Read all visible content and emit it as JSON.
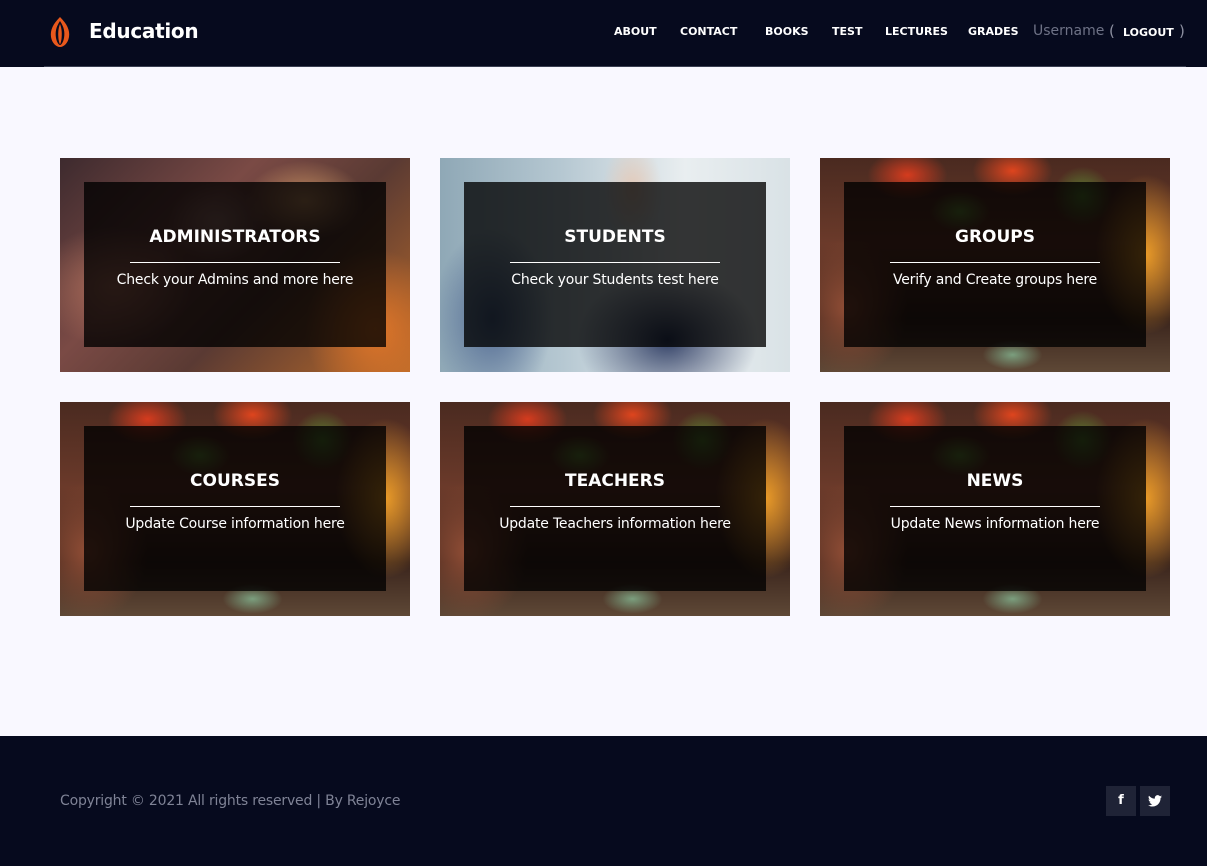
{
  "header": {
    "brand": "Education",
    "nav": [
      "ABOUT",
      "CONTACT",
      "BOOKS",
      "TEST",
      "LECTURES",
      "GRADES"
    ],
    "username": "Username",
    "open_paren": "(",
    "close_paren": ")",
    "logout": "LOGOUT"
  },
  "cards": [
    {
      "title": "ADMINISTRATORS",
      "text": "Check your Admins and more here"
    },
    {
      "title": "STUDENTS",
      "text": "Check your Students test here"
    },
    {
      "title": "GROUPS",
      "text": "Verify and Create groups here"
    },
    {
      "title": "COURSES",
      "text": "Update Course information here"
    },
    {
      "title": "TEACHERS",
      "text": "Update Teachers information here"
    },
    {
      "title": "NEWS",
      "text": "Update News information here"
    }
  ],
  "footer": {
    "copyright": "Copyright © 2021 All rights reserved | By Rejoyce",
    "social": [
      {
        "icon": "facebook-icon",
        "glyph": "f"
      },
      {
        "icon": "twitter-icon",
        "glyph": "🐦"
      }
    ]
  },
  "colors": {
    "header_bg": "#060a1e",
    "page_bg": "#f9f8ff",
    "logo_accent": "#e8581c"
  }
}
